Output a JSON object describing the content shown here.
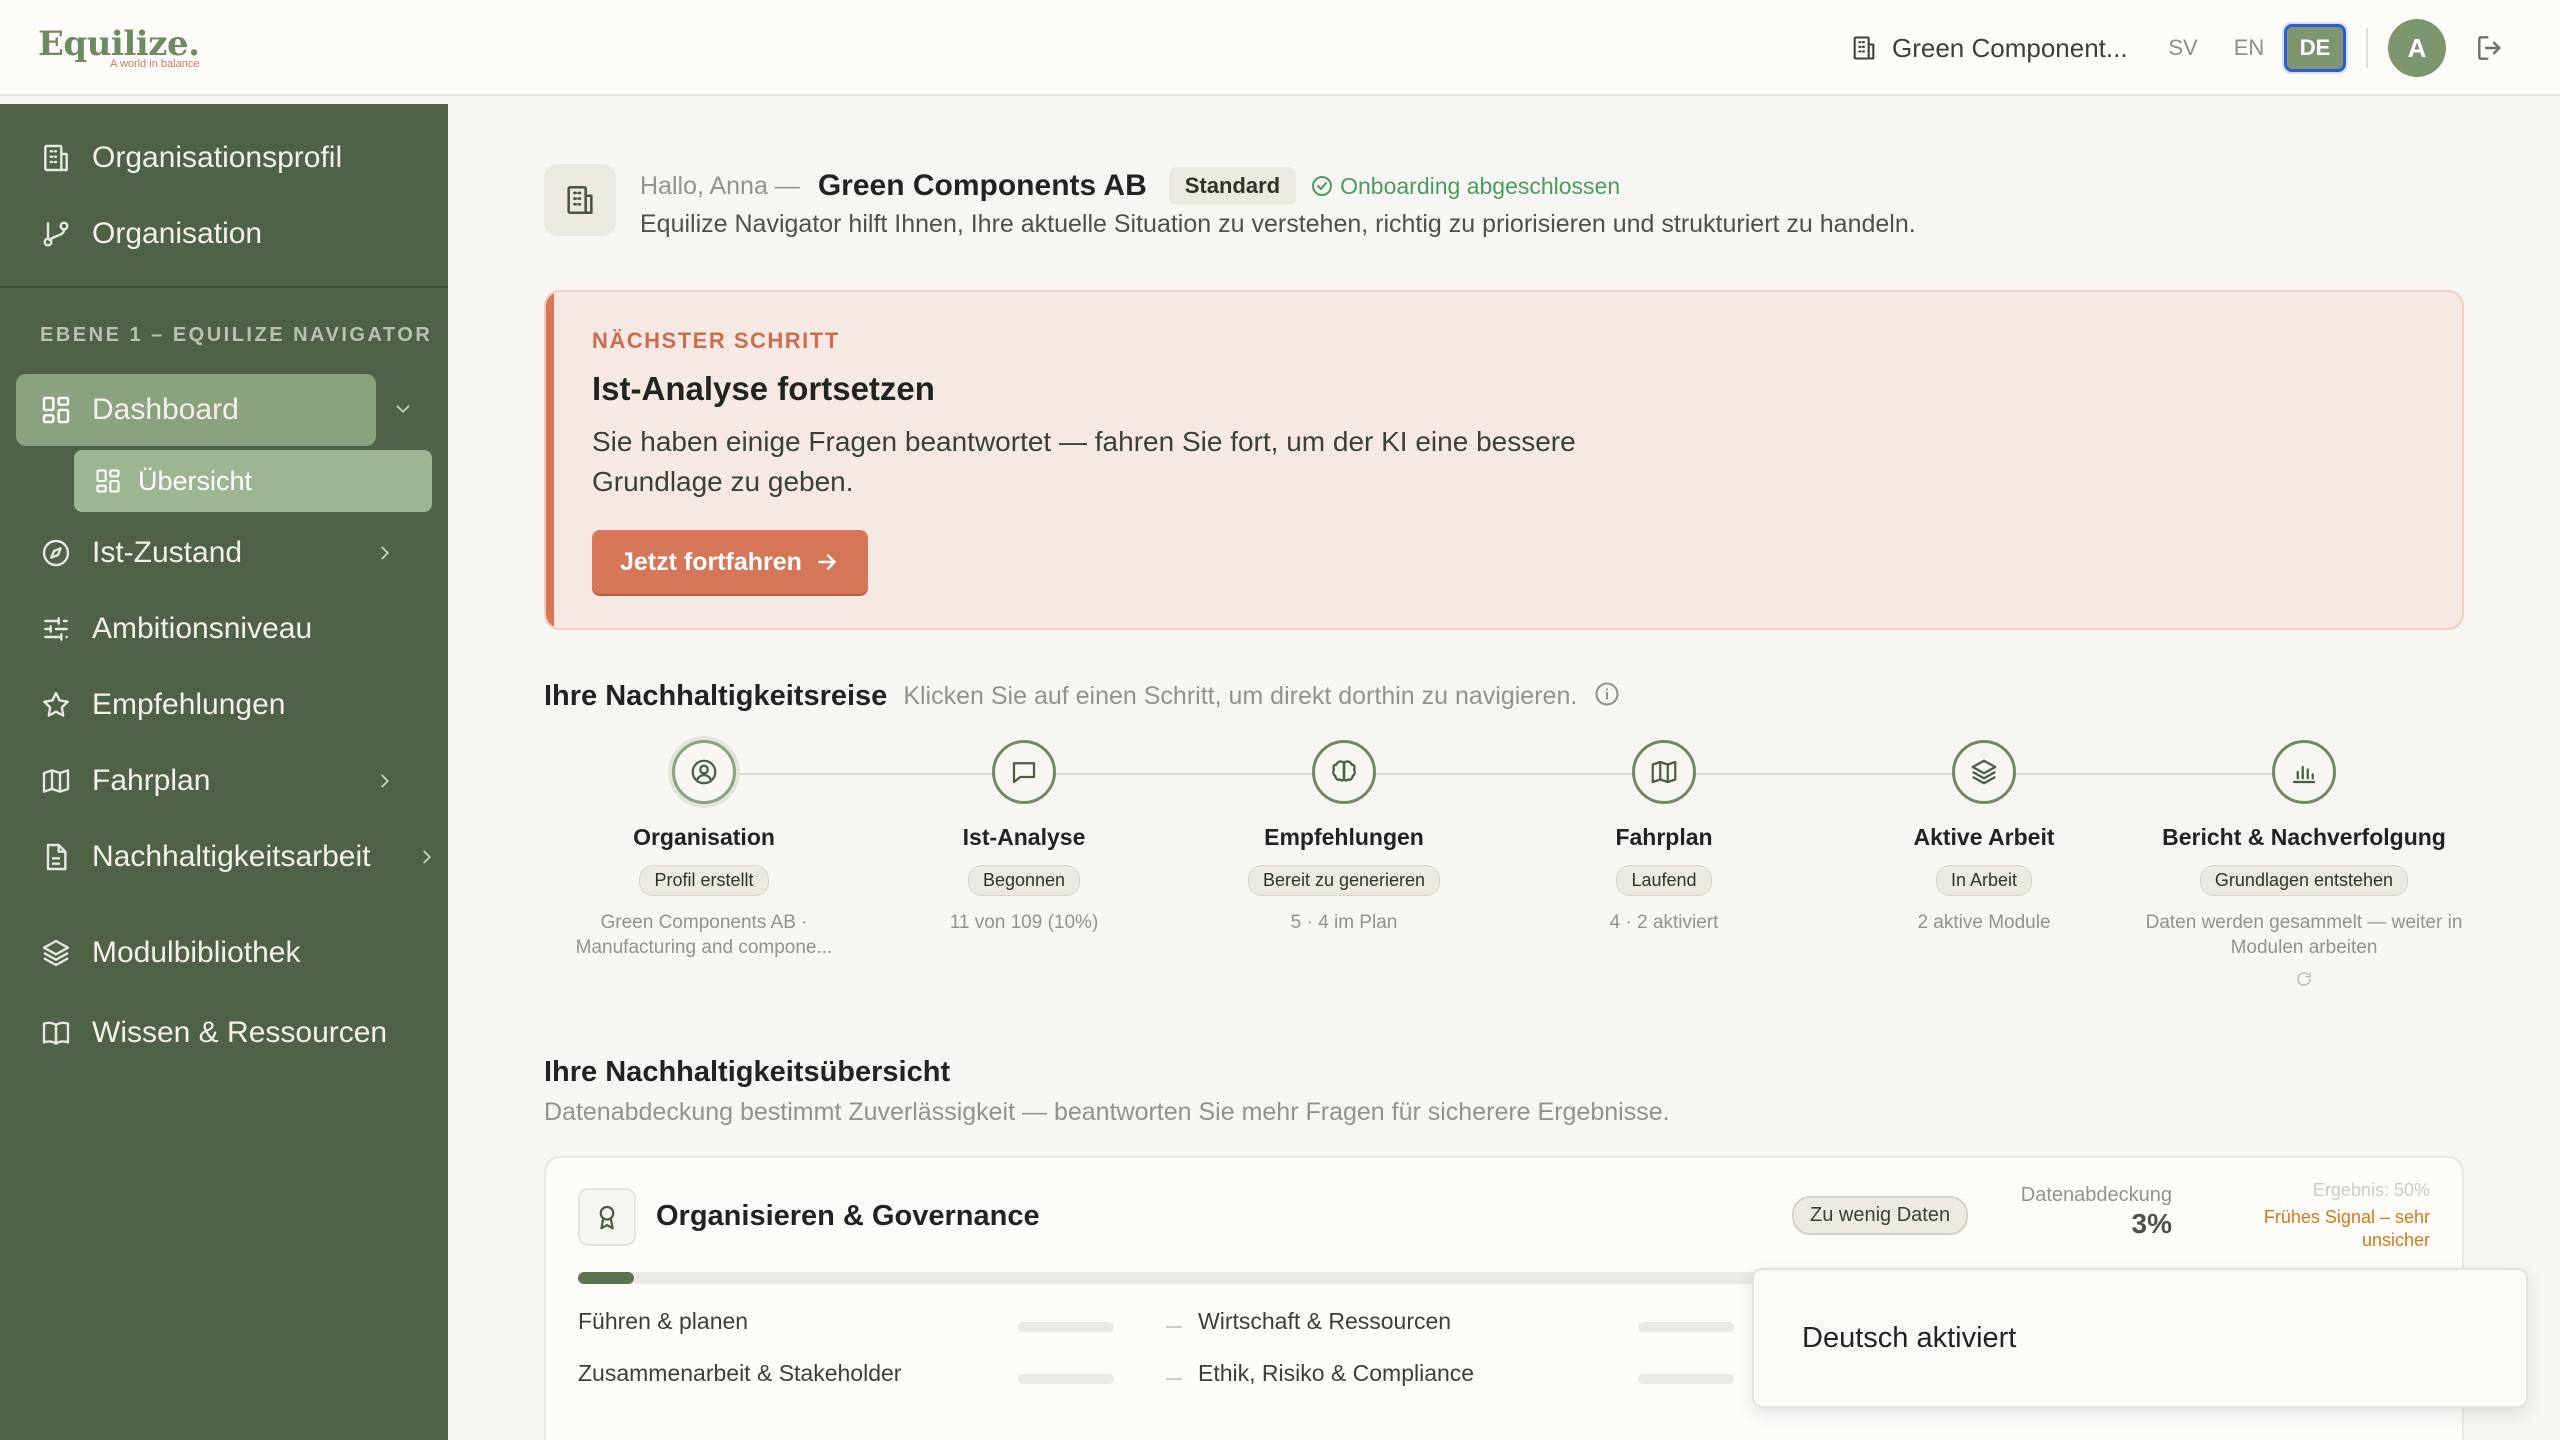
{
  "brand": {
    "name": "Equilize.",
    "tagline": "A world in balance"
  },
  "topbar": {
    "org_name": "Green Component...",
    "languages": [
      "SV",
      "EN",
      "DE"
    ],
    "active_language": "DE",
    "avatar_initial": "A"
  },
  "sidebar": {
    "top_items": [
      {
        "label": "Organisationsprofil",
        "icon": "building-icon"
      },
      {
        "label": "Organisation",
        "icon": "branch-icon"
      }
    ],
    "section_label": "EBENE 1 – EQUILIZE NAVIGATOR",
    "dashboard": {
      "label": "Dashboard",
      "icon": "grid-icon",
      "expanded": true
    },
    "dashboard_sub": {
      "label": "Übersicht",
      "icon": "grid-icon"
    },
    "items": [
      {
        "label": "Ist-Zustand",
        "icon": "compass-icon",
        "chevron": true
      },
      {
        "label": "Ambitionsniveau",
        "icon": "sliders-icon",
        "chevron": false
      },
      {
        "label": "Empfehlungen",
        "icon": "star-icon",
        "chevron": false
      },
      {
        "label": "Fahrplan",
        "icon": "map-icon",
        "chevron": true
      },
      {
        "label": "Nachhaltigkeitsarbeit",
        "icon": "document-icon",
        "chevron": true
      },
      {
        "label": "Modulbibliothek",
        "icon": "layers-icon",
        "chevron": false
      },
      {
        "label": "Wissen & Ressourcen",
        "icon": "book-icon",
        "chevron": false
      }
    ]
  },
  "greeting": {
    "hello": "Hallo, Anna —",
    "company": "Green Components AB",
    "tier": "Standard",
    "onboarding": "Onboarding abgeschlossen",
    "description": "Equilize Navigator hilft Ihnen, Ihre aktuelle Situation zu verstehen, richtig zu priorisieren und strukturiert zu handeln."
  },
  "next_step": {
    "label": "NÄCHSTER SCHRITT",
    "title": "Ist-Analyse fortsetzen",
    "description": "Sie haben einige Fragen beantwortet — fahren Sie fort, um der KI eine bessere Grundlage zu geben.",
    "button": "Jetzt fortfahren"
  },
  "journey": {
    "title": "Ihre Nachhaltigkeitsreise",
    "subtitle": "Klicken Sie auf einen Schritt, um direkt dorthin zu navigieren.",
    "steps": [
      {
        "name": "Organisation",
        "badge": "Profil erstellt",
        "meta": "Green Components AB · Manufacturing and compone...",
        "icon": "user-circle-icon"
      },
      {
        "name": "Ist-Analyse",
        "badge": "Begonnen",
        "meta": "11 von 109 (10%)",
        "icon": "chat-icon"
      },
      {
        "name": "Empfehlungen",
        "badge": "Bereit zu generieren",
        "meta": "5 · 4 im Plan",
        "icon": "brain-icon"
      },
      {
        "name": "Fahrplan",
        "badge": "Laufend",
        "meta": "4 · 2 aktiviert",
        "icon": "map-icon"
      },
      {
        "name": "Aktive Arbeit",
        "badge": "In Arbeit",
        "meta": "2 aktive Module",
        "icon": "layers-icon"
      },
      {
        "name": "Bericht & Nachverfolgung",
        "badge": "Grundlagen entstehen",
        "meta": "Daten werden gesammelt — weiter in Modulen arbeiten",
        "icon": "bar-chart-icon"
      }
    ]
  },
  "overview": {
    "title": "Ihre Nachhaltigkeitsübersicht",
    "subtitle": "Datenabdeckung bestimmt Zuverlässigkeit — beantworten Sie mehr Fragen für sicherere Ergebnisse.",
    "card": {
      "title": "Organisieren & Governance",
      "badge": "Zu wenig Daten",
      "coverage_label": "Datenabdeckung",
      "coverage_value": "3%",
      "coverage_fraction": 0.03,
      "result_label": "Ergebnis: 50%",
      "result_signal": "Frühes Signal – sehr unsicher",
      "subcategories": [
        "Führen & planen",
        "Wirtschaft & Ressourcen",
        "Zusammenarbeit & Stakeholder",
        "Ethik, Risiko & Compliance"
      ]
    }
  },
  "toast": {
    "message": "Deutsch aktiviert"
  },
  "colors": {
    "sidebar": "#4f6147",
    "accent": "#7d9670",
    "cta": "#d57659",
    "success": "#4a9a62",
    "warning": "#d07a1d"
  }
}
